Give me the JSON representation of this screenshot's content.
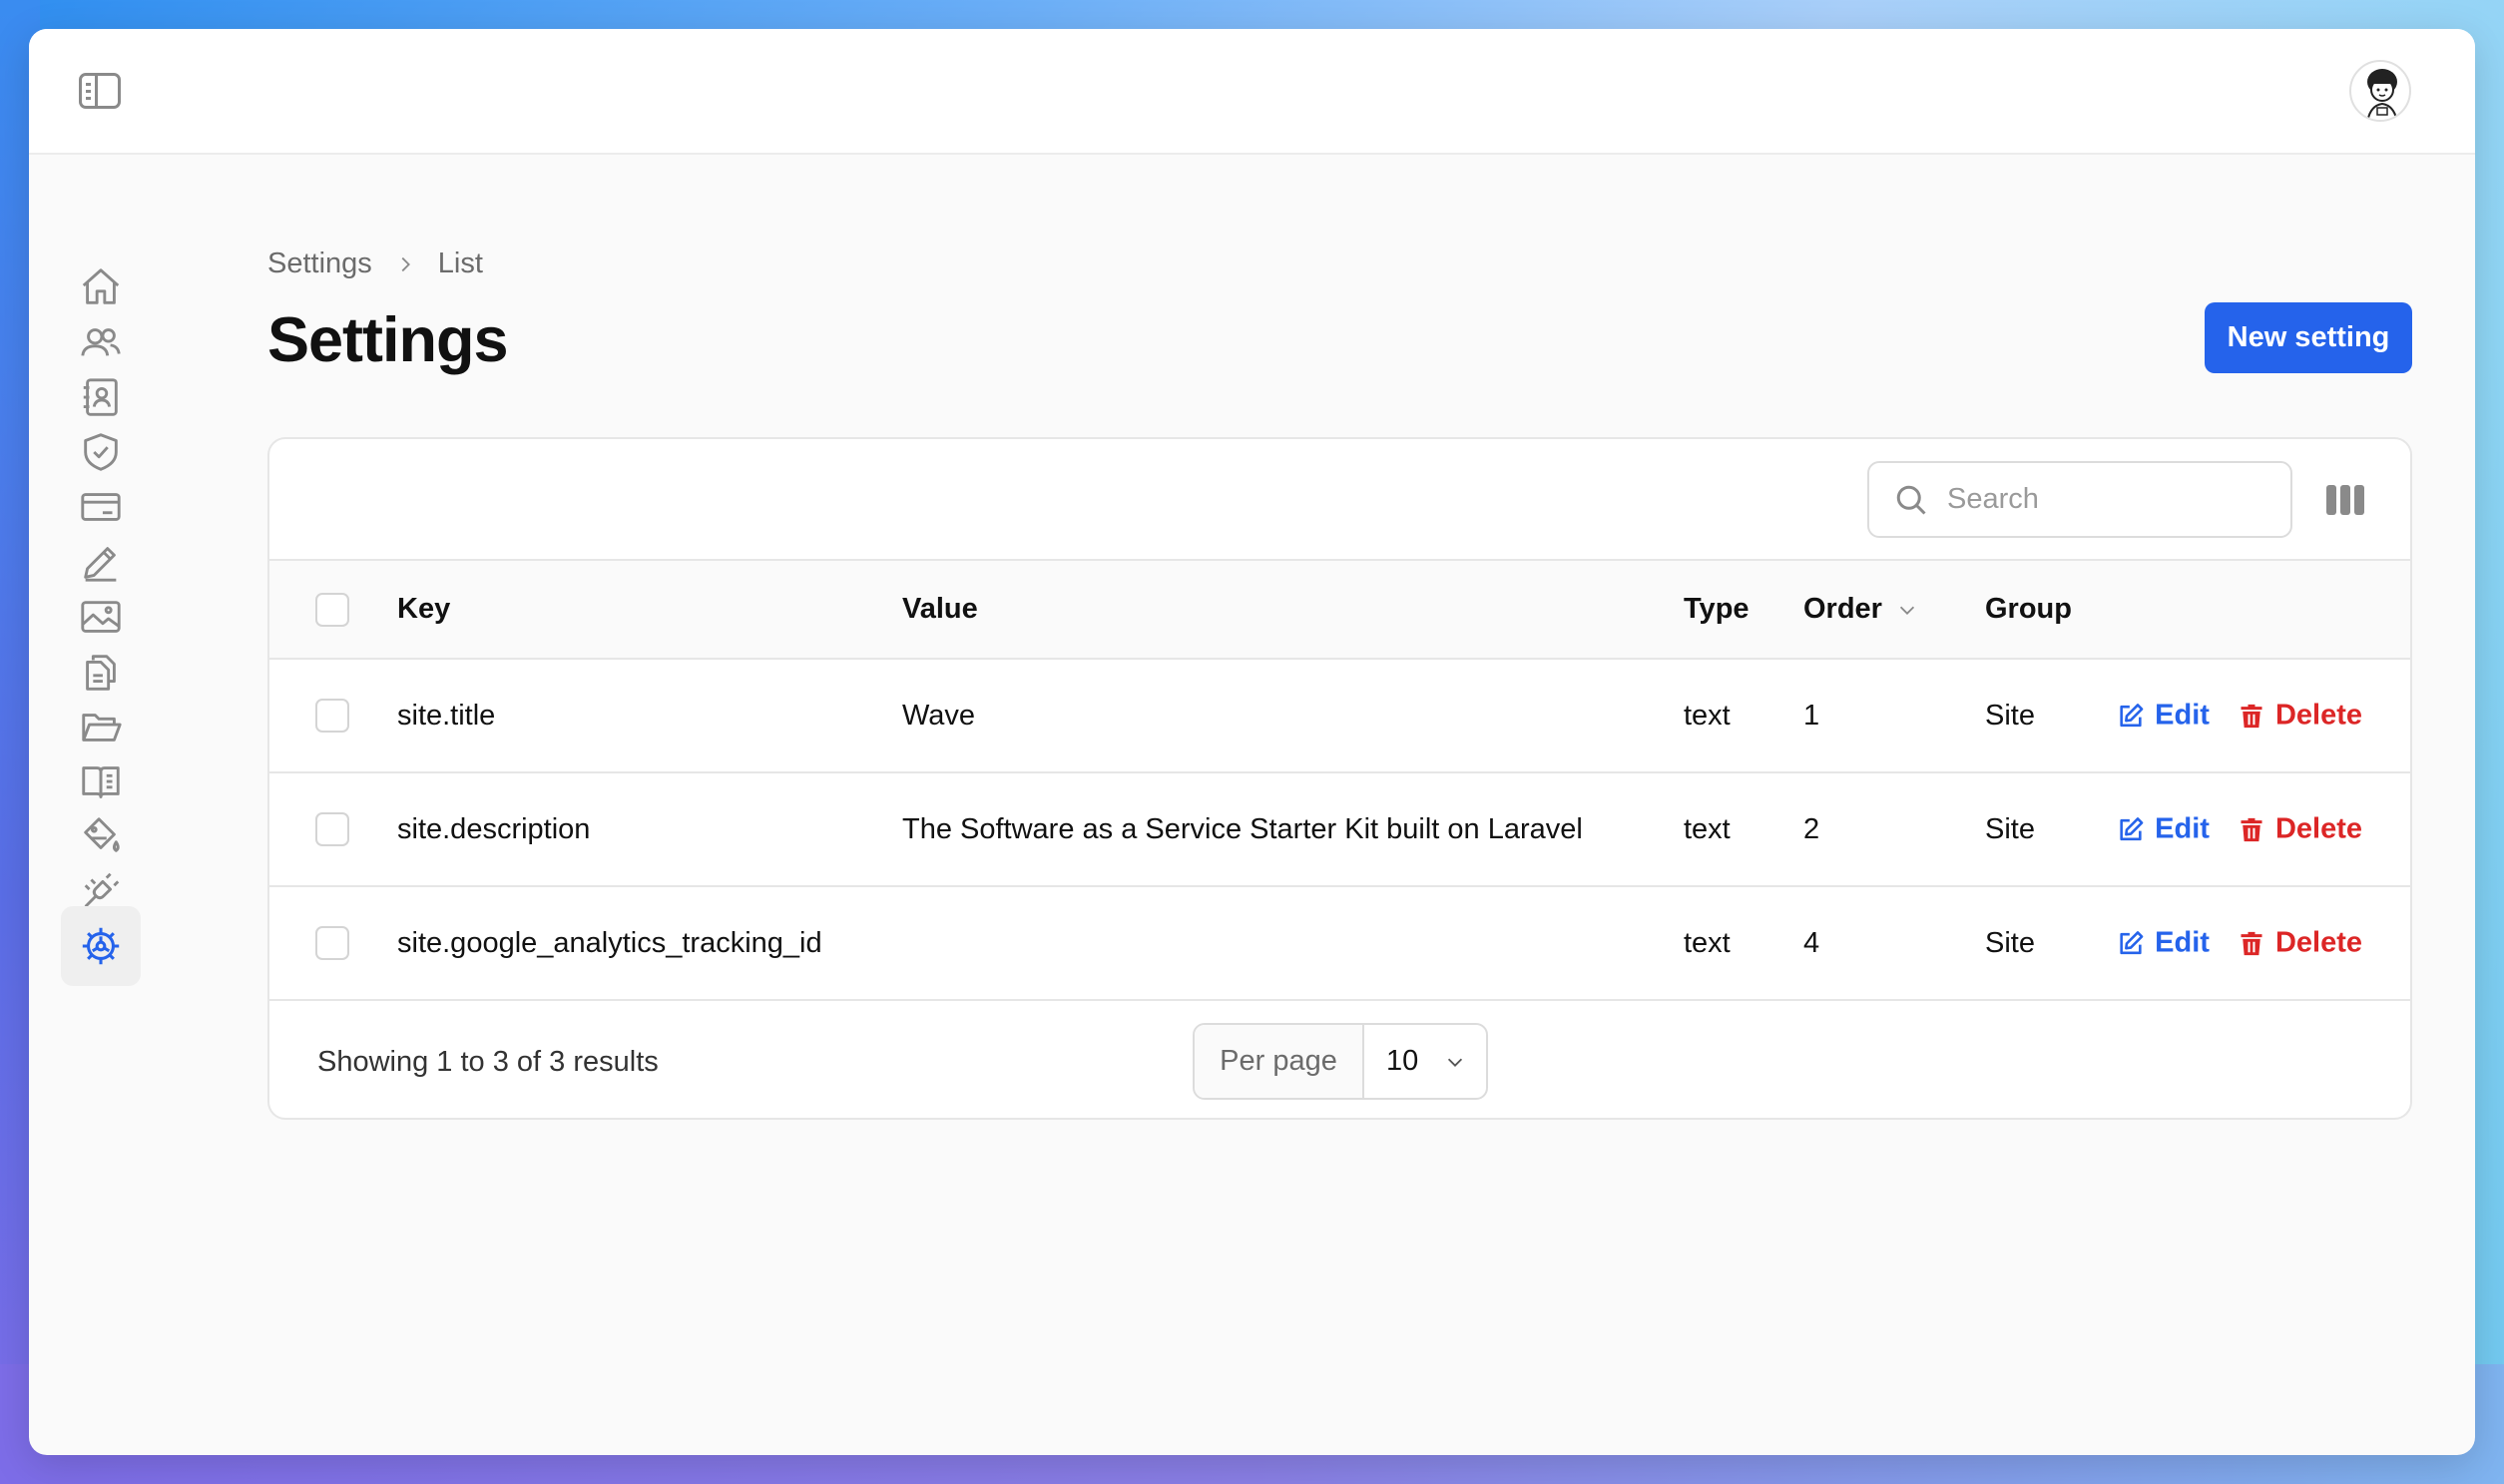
{
  "breadcrumb": {
    "root": "Settings",
    "current": "List"
  },
  "page": {
    "title": "Settings",
    "new_button": "New setting"
  },
  "search": {
    "placeholder": "Search"
  },
  "table": {
    "headers": {
      "key": "Key",
      "value": "Value",
      "type": "Type",
      "order": "Order",
      "group": "Group"
    },
    "rows": [
      {
        "key": "site.title",
        "value": "Wave",
        "type": "text",
        "order": "1",
        "group": "Site",
        "edit": "Edit",
        "delete": "Delete"
      },
      {
        "key": "site.description",
        "value": "The Software as a Service Starter Kit built on Laravel",
        "type": "text",
        "order": "2",
        "group": "Site",
        "edit": "Edit",
        "delete": "Delete"
      },
      {
        "key": "site.google_analytics_tracking_id",
        "value": "",
        "type": "text",
        "order": "4",
        "group": "Site",
        "edit": "Edit",
        "delete": "Delete"
      }
    ]
  },
  "pagination": {
    "showing": "Showing 1 to 3 of 3 results",
    "per_page_label": "Per page",
    "per_page_value": "10"
  },
  "sidebar": {
    "items": [
      {
        "icon": "home-icon"
      },
      {
        "icon": "users-icon"
      },
      {
        "icon": "contacts-icon"
      },
      {
        "icon": "shield-check-icon"
      },
      {
        "icon": "credit-card-icon"
      },
      {
        "icon": "pencil-icon"
      },
      {
        "icon": "image-icon"
      },
      {
        "icon": "documents-icon"
      },
      {
        "icon": "folder-icon"
      },
      {
        "icon": "book-icon"
      },
      {
        "icon": "paint-bucket-icon"
      },
      {
        "icon": "plug-icon"
      },
      {
        "icon": "gear-icon",
        "active": true
      }
    ]
  },
  "colors": {
    "primary": "#2563eb",
    "danger": "#dc2626",
    "active_icon": "#2563eb"
  }
}
